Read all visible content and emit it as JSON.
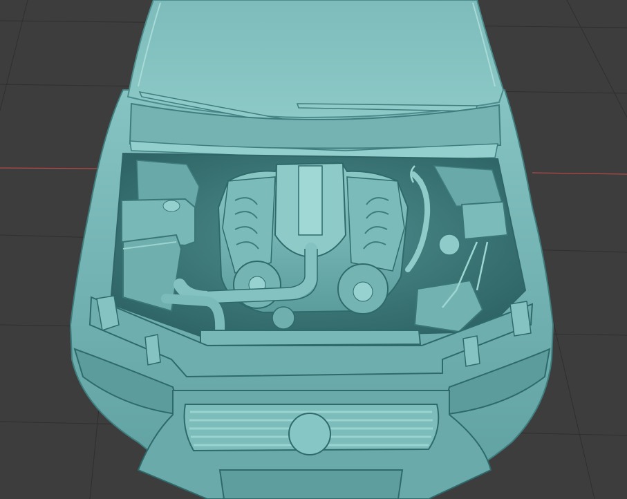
{
  "viewport": {
    "background_color": "#3d3d3d",
    "grid_color": "#2f2f2f",
    "x_axis_color": "#b34949",
    "model_base_color": "#6fb3b3",
    "model_light_color": "#9fd3d1",
    "model_dark_color": "#3f7d7e"
  },
  "scene": {
    "object": "car-front-engine-bay",
    "parts": [
      "windshield",
      "wiper-left",
      "wiper-right",
      "cowl-panel",
      "engine-block",
      "intake-manifold",
      "air-filter-box",
      "battery",
      "coolant-reservoir",
      "front-bumper",
      "grille",
      "emblem",
      "headlight-left",
      "headlight-right",
      "radiator-support"
    ]
  }
}
